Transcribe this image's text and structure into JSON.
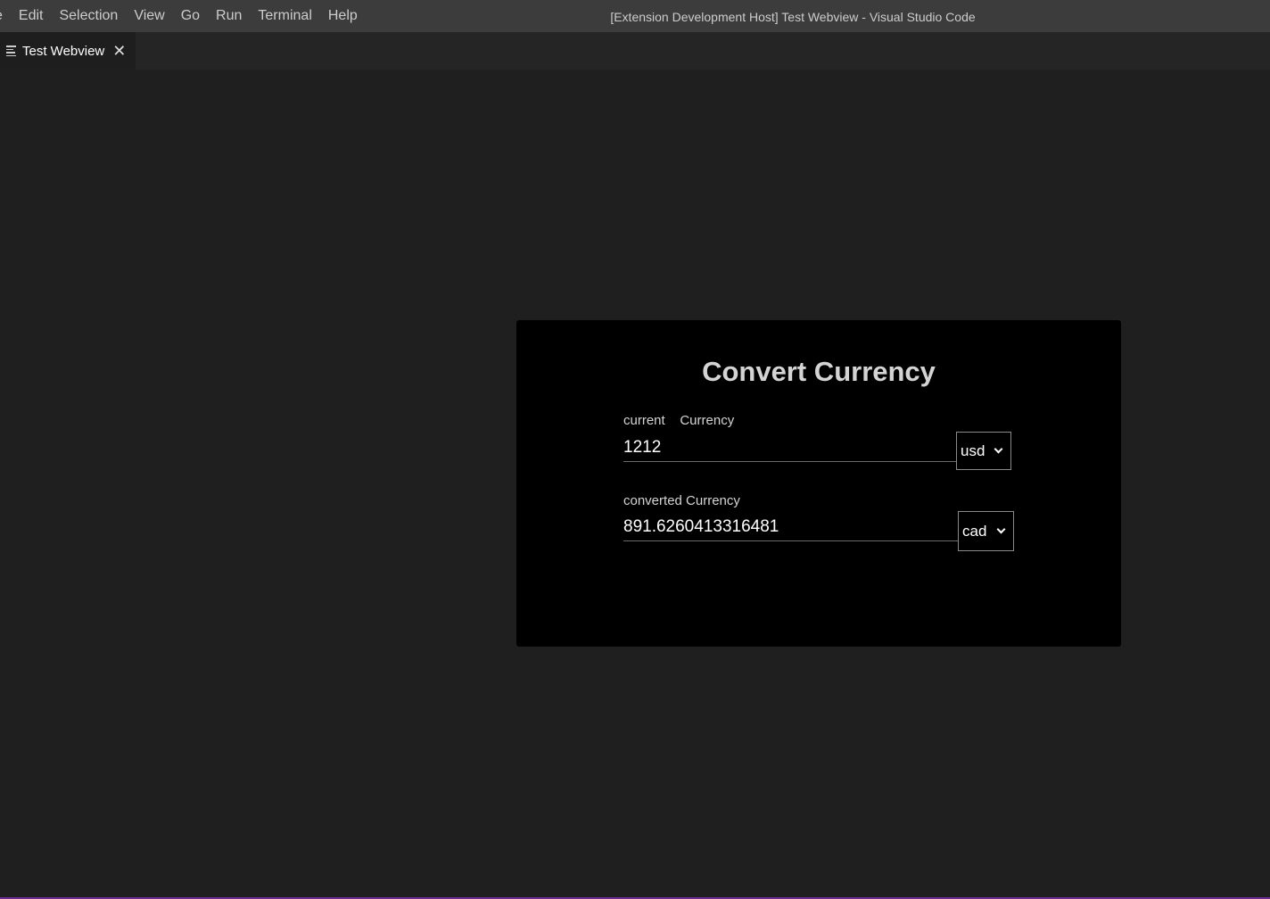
{
  "titlebar": {
    "menu": [
      "e",
      "Edit",
      "Selection",
      "View",
      "Go",
      "Run",
      "Terminal",
      "Help"
    ],
    "window_title": "[Extension Development Host] Test Webview - Visual Studio Code"
  },
  "tab": {
    "label": "Test Webview",
    "icon": "preview-lines-icon",
    "close": "✕"
  },
  "converter": {
    "title": "Convert Currency",
    "current": {
      "label": "current    Currency",
      "value": "1212",
      "currency": "usd"
    },
    "converted": {
      "label": "converted Currency",
      "value": "891.6260413316481",
      "currency": "cad"
    }
  },
  "colors": {
    "titlebar": "#3c3c3c",
    "editor_bg": "#1f1f1f",
    "card_bg": "#000000",
    "status_accent": "#6b2d91"
  }
}
